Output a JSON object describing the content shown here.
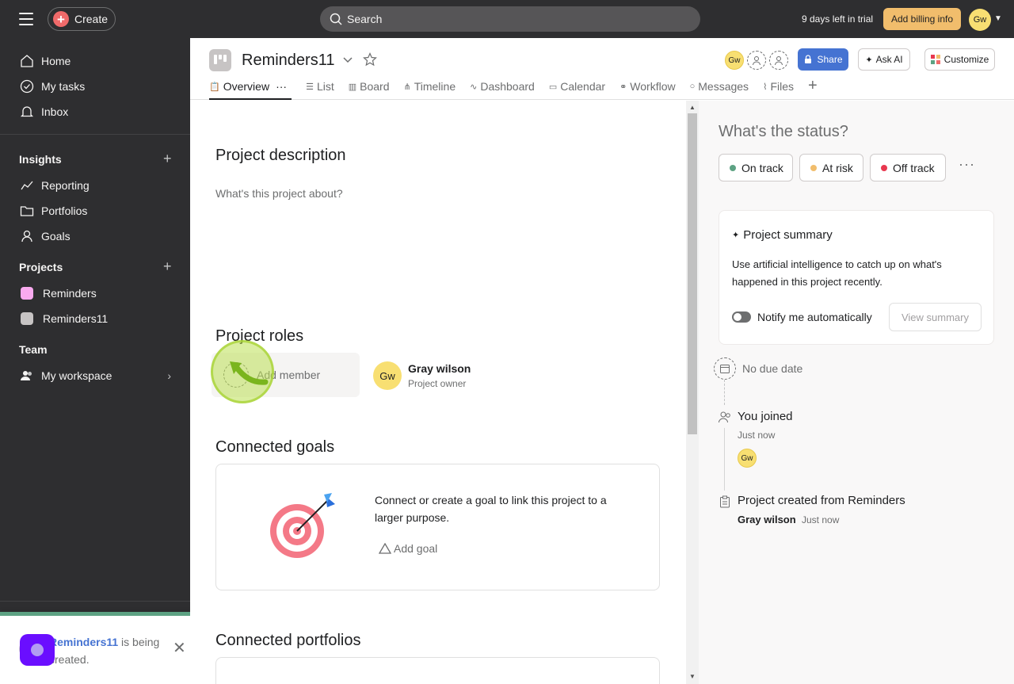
{
  "topbar": {
    "create_label": "Create",
    "search_placeholder": "Search",
    "trial_text": "9 days left in trial",
    "billing_label": "Add billing info",
    "user_initials": "Gw"
  },
  "sidebar": {
    "main_items": [
      {
        "label": "Home",
        "icon": "home-icon"
      },
      {
        "label": "My tasks",
        "icon": "check-circle-icon"
      },
      {
        "label": "Inbox",
        "icon": "bell-icon"
      }
    ],
    "insights": {
      "heading": "Insights",
      "items": [
        {
          "label": "Reporting",
          "icon": "line-chart-icon"
        },
        {
          "label": "Portfolios",
          "icon": "folder-icon"
        },
        {
          "label": "Goals",
          "icon": "person-icon"
        }
      ]
    },
    "projects": {
      "heading": "Projects",
      "items": [
        {
          "label": "Reminders",
          "color": "#f9aaef"
        },
        {
          "label": "Reminders11",
          "color": "#c7c4c4"
        }
      ]
    },
    "team": {
      "heading": "Team",
      "workspace_label": "My workspace"
    }
  },
  "toast": {
    "project_name": "Reminders11",
    "message": " is being created."
  },
  "header": {
    "project_title": "Reminders11",
    "member_initials": "Gw",
    "share_label": "Share",
    "ask_ai_label": "Ask AI",
    "customize_label": "Customize",
    "tabs": [
      {
        "label": "Overview",
        "icon": "clipboard-icon"
      },
      {
        "label": "List",
        "icon": "list-icon"
      },
      {
        "label": "Board",
        "icon": "board-icon"
      },
      {
        "label": "Timeline",
        "icon": "timeline-icon"
      },
      {
        "label": "Dashboard",
        "icon": "dashboard-icon"
      },
      {
        "label": "Calendar",
        "icon": "calendar-icon"
      },
      {
        "label": "Workflow",
        "icon": "workflow-icon"
      },
      {
        "label": "Messages",
        "icon": "message-icon"
      },
      {
        "label": "Files",
        "icon": "paperclip-icon"
      }
    ]
  },
  "main": {
    "description_heading": "Project description",
    "description_placeholder": "What's this project about?",
    "roles_heading": "Project roles",
    "add_member_label": "Add member",
    "owner": {
      "initials": "Gw",
      "name": "Gray wilson",
      "role": "Project owner"
    },
    "goals_heading": "Connected goals",
    "goals_text": "Connect or create a goal to link this project to a larger purpose.",
    "add_goal_label": "Add goal",
    "portfolios_heading": "Connected portfolios"
  },
  "status_panel": {
    "question": "What's the status?",
    "options": [
      {
        "label": "On track",
        "color": "#5da283"
      },
      {
        "label": "At risk",
        "color": "#f1bd6c"
      },
      {
        "label": "Off track",
        "color": "#e8384f"
      }
    ],
    "summary": {
      "title": "Project summary",
      "description": "Use artificial intelligence to catch up on what's happened in this project recently.",
      "notify_label": "Notify me automatically",
      "view_label": "View summary"
    },
    "due_date": "No due date",
    "activity": [
      {
        "title": "You joined",
        "time": "Just now",
        "avatar": "Gw"
      },
      {
        "title": "Project created from Reminders",
        "author": "Gray wilson",
        "time": "Just now"
      }
    ]
  }
}
